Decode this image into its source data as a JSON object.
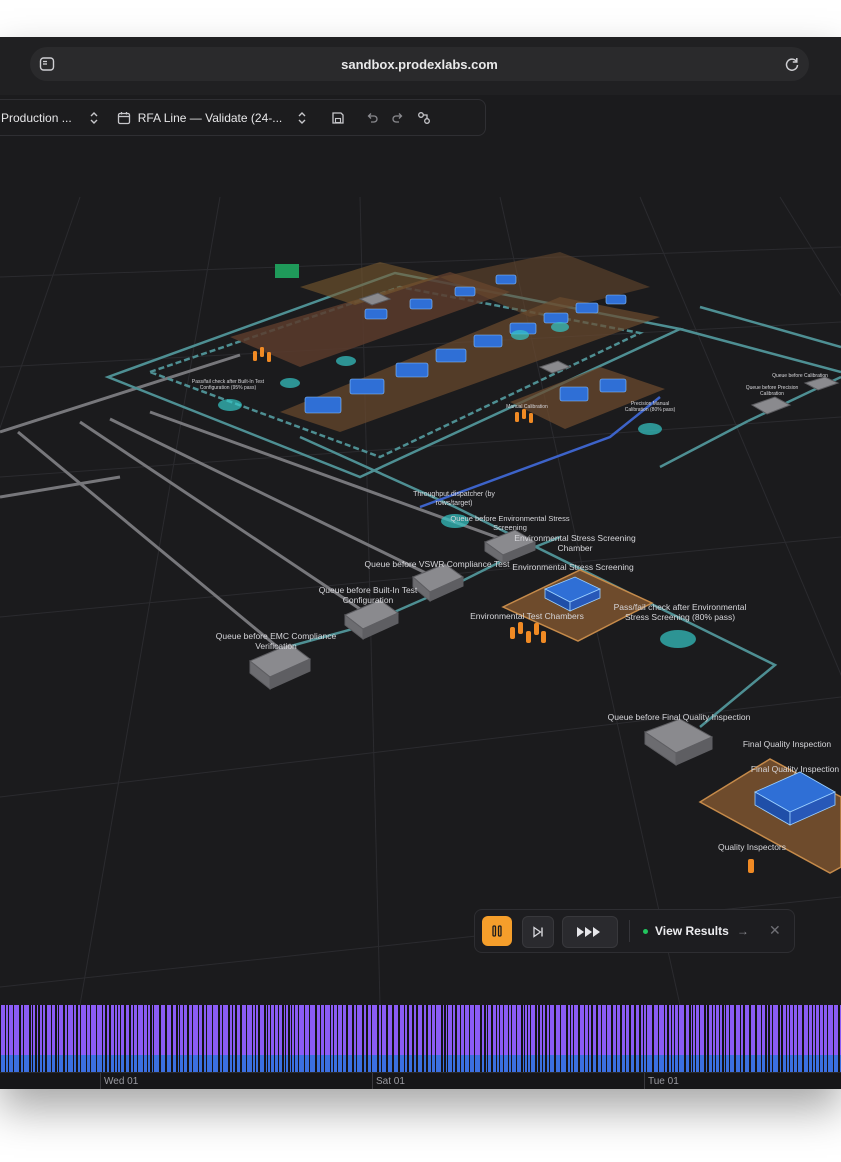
{
  "browser": {
    "url": "sandbox.prodexlabs.com"
  },
  "toolbar": {
    "project_label": "Production ...",
    "scenario_label": "RFA Line — Validate (24-..."
  },
  "scene": {
    "labels": {
      "q_emc": "Queue before EMC Compliance",
      "q_emc2": "Verification",
      "q_bit": "Queue before Built-In Test",
      "q_bit2": "Configuration",
      "q_vswr": "Queue before VSWR Compliance Test",
      "dispatcher": "Throughput dispatcher (by",
      "dispatcher2": "rows/target)",
      "q_ess": "Queue before Environmental Stress",
      "q_ess2": "Screening",
      "ess_chamber": "Environmental Stress Screening",
      "ess_chamber2": "Chamber",
      "ess": "Environmental Stress Screening",
      "env_chambers": "Environmental Test Chambers",
      "pf_ess": "Pass/fail check after Environmental",
      "pf_ess2": "Stress Screening (80% pass)",
      "q_fqi": "Queue before Final Quality Inspection",
      "fqi": "Final Quality Inspection",
      "fqi2": "Final Quality Inspection",
      "quality_inspectors": "Quality Inspectors",
      "pf_bit": "Pass/fail check after Built-In Test",
      "pf_bit2": "Configuration (95% pass)",
      "q_precision": "Queue before Precision",
      "q_precision2": "Calibration",
      "q_calib": "Queue before Calibration",
      "manual_cal": "Manual Calibration",
      "precision_manual": "Precision Manual",
      "precision_manual2": "Calibration (80% pass)"
    }
  },
  "controls": {
    "view_results_label": "View Results",
    "status_color": "#22c55e",
    "accent_color": "#f59e2b"
  },
  "timeline": {
    "labels": [
      "Wed 01",
      "Sat 01",
      "Tue 01"
    ],
    "series_colors": [
      "#8b5cf6",
      "#3b6fe0"
    ]
  }
}
